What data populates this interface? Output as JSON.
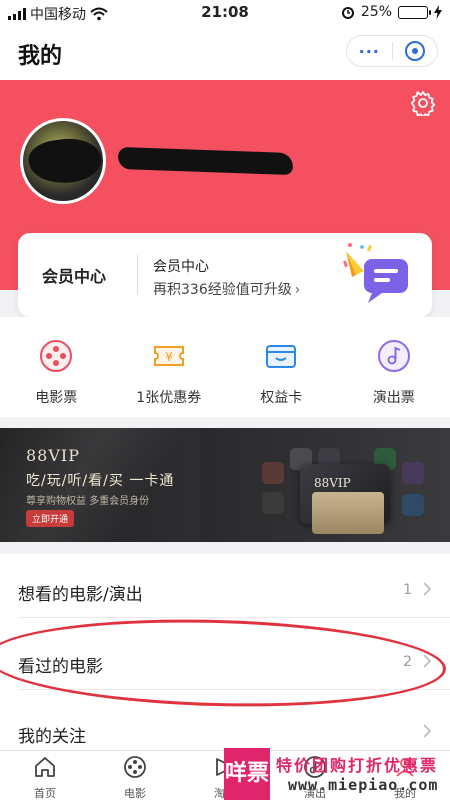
{
  "status_bar": {
    "carrier": "中国移动",
    "time": "21:08",
    "battery": "25%",
    "battery_level": 0.25
  },
  "header": {
    "title": "我的",
    "more_icon": "ellipsis-icon",
    "close_icon": "target-close-icon"
  },
  "profile": {
    "settings_icon": "gear-icon",
    "avatar": "avatar-redacted",
    "name_redacted": true
  },
  "member_card": {
    "left_title": "会员中心",
    "right_title": "会员中心",
    "subtitle": "再积336经验值可升级",
    "chevron": "›",
    "illustration": "party-popper-icon"
  },
  "quick_actions": [
    {
      "label": "电影票",
      "icon": "film-reel-icon"
    },
    {
      "label": "1张优惠券",
      "icon": "coupon-yen-icon"
    },
    {
      "label": "权益卡",
      "icon": "card-wallet-icon"
    },
    {
      "label": "演出票",
      "icon": "music-note-icon"
    }
  ],
  "banner": {
    "brand": "88VIP",
    "headline": "吃/玩/听/看/买  一卡通",
    "subline": "尊享购物权益  多重会员身份",
    "cta": "立即开通",
    "card_label": "88VIP"
  },
  "list": [
    {
      "label": "想看的电影/演出",
      "count": "1"
    },
    {
      "label": "看过的电影",
      "count": "2"
    },
    {
      "label": "我的关注",
      "count": ""
    }
  ],
  "tabbar": [
    {
      "label": "首页",
      "icon": "home-icon"
    },
    {
      "label": "电影",
      "icon": "film-reel-icon"
    },
    {
      "label": "淘气",
      "icon": "play-flag-icon"
    },
    {
      "label": "演出",
      "icon": "music-note-icon"
    },
    {
      "label": "我的",
      "icon": "user-icon"
    }
  ],
  "watermark": {
    "logo": "咩票",
    "text": "特价团购打折优惠票",
    "url": "www.miepiao.com"
  },
  "colors": {
    "brand_red": "#f5505f",
    "annotation_red": "#e0323f",
    "watermark_pink": "#e0266a",
    "accent_blue": "#2c6bd9"
  }
}
